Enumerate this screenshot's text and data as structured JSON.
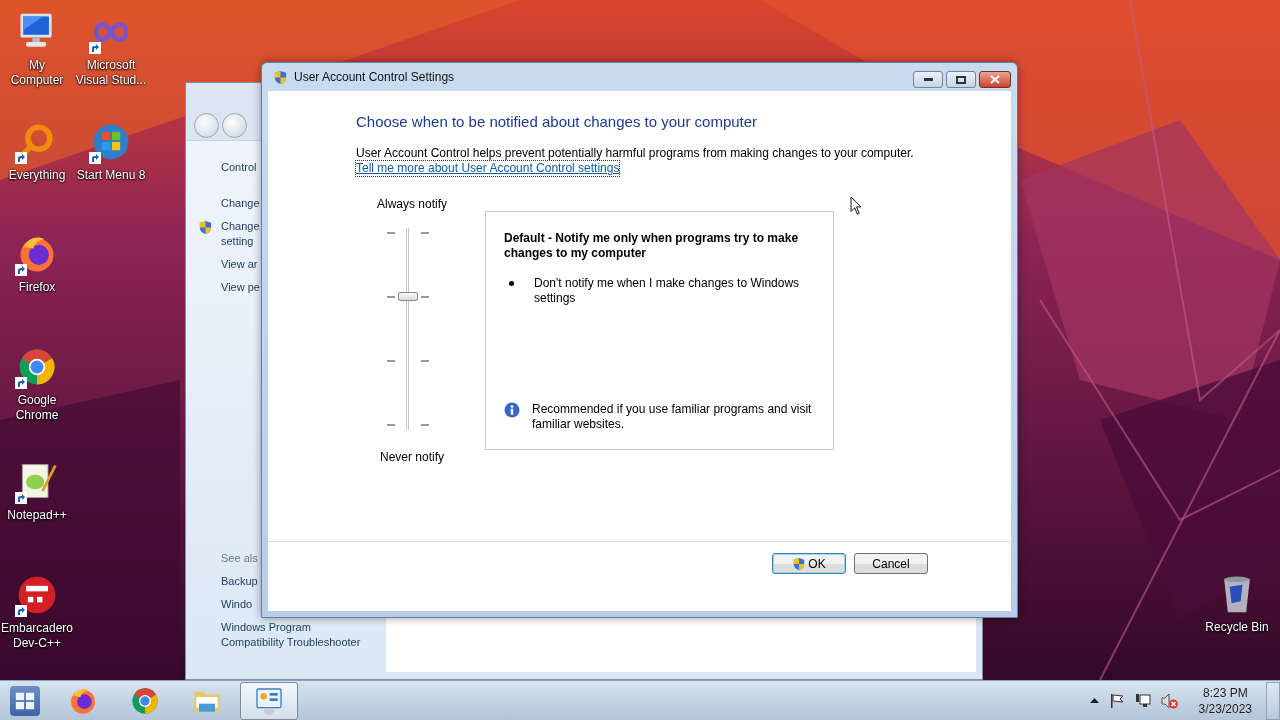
{
  "desktop_icons": [
    {
      "lines": [
        "My",
        "Computer"
      ],
      "kind": "computer",
      "shortcut": false
    },
    {
      "lines": [
        "Microsoft",
        "Visual Stud..."
      ],
      "kind": "vs",
      "shortcut": true
    },
    {
      "lines": [
        "Everything"
      ],
      "kind": "everything",
      "shortcut": true
    },
    {
      "lines": [
        "Start Menu 8"
      ],
      "kind": "startmenu",
      "shortcut": true
    },
    {
      "lines": [
        "Firefox"
      ],
      "kind": "firefox",
      "shortcut": true
    },
    {
      "lines": [
        "Google",
        "Chrome"
      ],
      "kind": "chrome",
      "shortcut": true
    },
    {
      "lines": [
        "Notepad++"
      ],
      "kind": "notepad",
      "shortcut": true
    },
    {
      "lines": [
        "Embarcadero",
        "Dev-C++"
      ],
      "kind": "devcpp",
      "shortcut": true
    },
    {
      "lines": [
        "Recycle Bin"
      ],
      "kind": "recycle",
      "shortcut": false
    }
  ],
  "back_window": {
    "tasks": [
      {
        "lines": [
          "Control"
        ],
        "shield": false
      },
      {
        "lines": [
          "Change"
        ],
        "shield": false
      },
      {
        "lines": [
          "Change",
          "setting"
        ],
        "shield": true
      },
      {
        "lines": [
          "View ar"
        ],
        "shield": false
      },
      {
        "lines": [
          "View pe"
        ],
        "shield": false
      }
    ],
    "see_also_heading": "See als",
    "see_also": [
      "Backup",
      "Windo",
      "Windows Program Compatibility Troubleshooter"
    ]
  },
  "dialog": {
    "title": "User Account Control Settings",
    "heading": "Choose when to be notified about changes to your computer",
    "description": "User Account Control helps prevent potentially harmful programs from making changes to your computer.",
    "link": "Tell me more about User Account Control settings",
    "slider": {
      "top_label": "Always notify",
      "bottom_label": "Never notify",
      "level": 0.67
    },
    "info": {
      "title": "Default - Notify me only when programs try to make changes to my computer",
      "bullets": [
        "Don't notify me when I make changes to Windows settings"
      ],
      "note": "Recommended if you use familiar programs and visit familiar websites."
    },
    "buttons": [
      {
        "label": "OK",
        "shield": true,
        "default": true
      },
      {
        "label": "Cancel",
        "shield": false,
        "default": false
      }
    ]
  },
  "taskbar": {
    "apps": [
      {
        "kind": "firefox",
        "selected": false
      },
      {
        "kind": "chrome",
        "selected": false
      },
      {
        "kind": "explorer",
        "selected": false
      },
      {
        "kind": "controlpanel",
        "selected": true
      }
    ],
    "clock": {
      "time": "8:23 PM",
      "date": "3/23/2023"
    }
  }
}
